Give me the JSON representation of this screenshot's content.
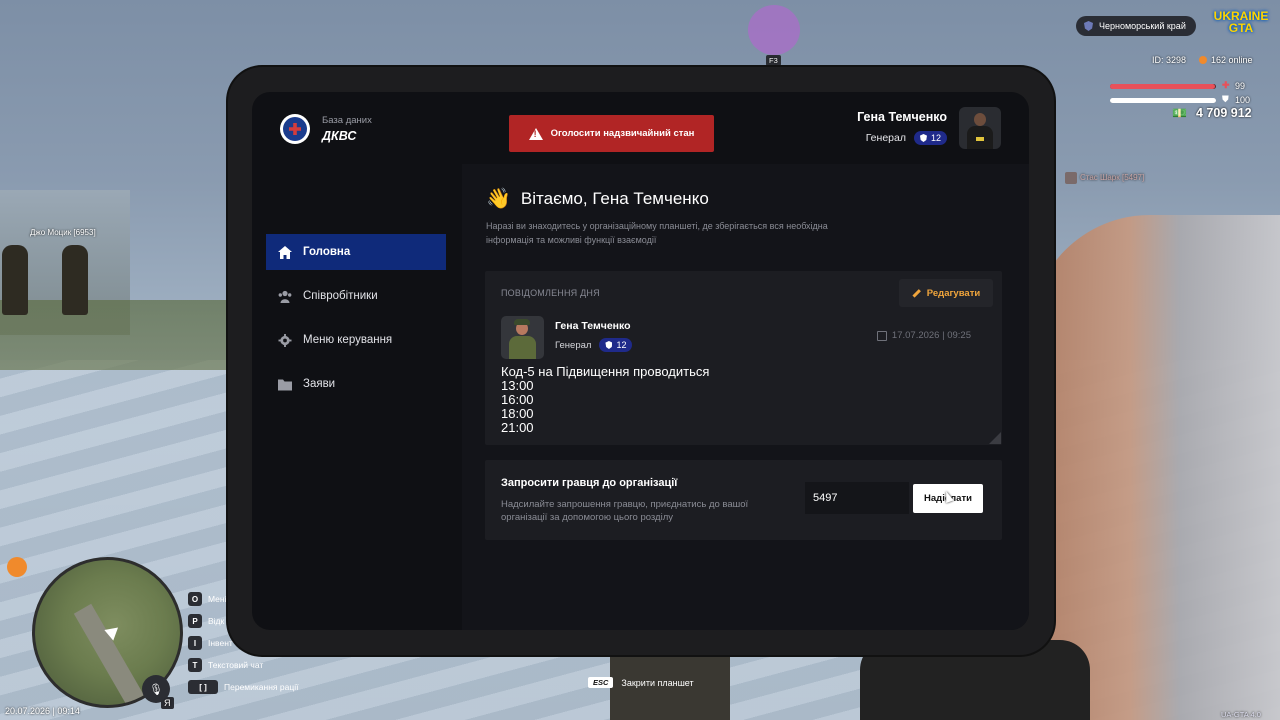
{
  "hud": {
    "region": "Черноморський край",
    "logo_line1": "UKRAINE",
    "logo_line2": "GTA",
    "id_label": "ID: 3298",
    "online": "162 online",
    "health": "99",
    "armor": "100",
    "health_level": 0.99,
    "armor_level": 1.0,
    "money": "4 709 912",
    "player_tag_right": "Стас Шарк [5497]",
    "player_tag_left": "Джо Моцик [6953]",
    "f3_key": "F3",
    "datetime": "20.07.2026 | 09:14",
    "version": "UA-GTA 4.0",
    "mic_key": "Я",
    "hotkeys": [
      {
        "key": "O",
        "label": "Мені"
      },
      {
        "key": "P",
        "label": "Відк"
      },
      {
        "key": "I",
        "label": "Інвент"
      },
      {
        "key": "T",
        "label": "Текстовий чат"
      },
      {
        "key": "[ ]",
        "label": "Перемикання рації"
      }
    ],
    "esc_key": "ESC",
    "esc_label": "Закрити планшет"
  },
  "tablet": {
    "db_subtitle": "База даних",
    "db_title": "ДКВС",
    "emergency_label": "Оголосити надзвичайний стан",
    "user": {
      "name": "Гена Темченко",
      "rank": "Генерал",
      "rank_level": "12"
    },
    "nav": [
      {
        "label": "Головна",
        "icon": "home-icon"
      },
      {
        "label": "Співробітники",
        "icon": "users-icon"
      },
      {
        "label": "Меню керування",
        "icon": "gear-icon"
      },
      {
        "label": "Заяви",
        "icon": "folder-icon"
      }
    ],
    "greeting": "Вітаємо, Гена Темченко",
    "greeting_sub": "Наразі ви знаходитесь у організаційному планшеті, де зберігається вся необхідна інформація та можливі функції взаємодії",
    "motd": {
      "label": "ПОВІДОМЛЕННЯ ДНЯ",
      "edit_label": "Редагувати",
      "author": "Гена Темченко",
      "author_rank": "Генерал",
      "author_level": "12",
      "date": "17.07.2026 | 09:25",
      "body": "Код-5 на Підвищення проводиться\n13:00\n16:00\n18:00\n21:00"
    },
    "invite": {
      "title": "Запросити гравця до організації",
      "description": "Надсилайте запрошення гравцю, приєднатись до вашої організації за допомогою цього розділу",
      "input_value": "5497",
      "button_label": "Надіслати"
    }
  },
  "colors": {
    "accent_blue": "#0f2a7a",
    "danger_red": "#b12525",
    "edit_orange": "#f0a53c",
    "health_red": "#e8515a"
  }
}
